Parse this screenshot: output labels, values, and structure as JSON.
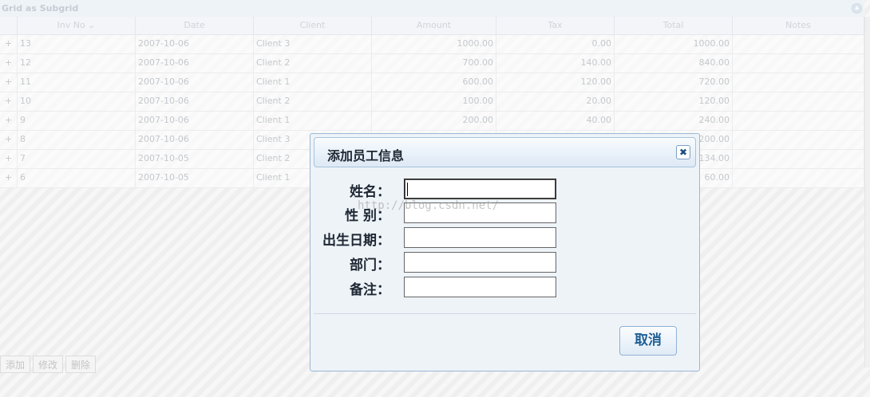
{
  "grid": {
    "caption": "Grid as Subgrid",
    "columns": [
      "Inv No",
      "Date",
      "Client",
      "Amount",
      "Tax",
      "Total",
      "Notes"
    ],
    "sort_indicator": "⌄",
    "rows": [
      {
        "inv": "13",
        "date": "2007-10-06",
        "client": "Client 3",
        "amount": "1000.00",
        "tax": "0.00",
        "total": "1000.00",
        "notes": ""
      },
      {
        "inv": "12",
        "date": "2007-10-06",
        "client": "Client 2",
        "amount": "700.00",
        "tax": "140.00",
        "total": "840.00",
        "notes": ""
      },
      {
        "inv": "11",
        "date": "2007-10-06",
        "client": "Client 1",
        "amount": "600.00",
        "tax": "120.00",
        "total": "720.00",
        "notes": ""
      },
      {
        "inv": "10",
        "date": "2007-10-06",
        "client": "Client 2",
        "amount": "100.00",
        "tax": "20.00",
        "total": "120.00",
        "notes": ""
      },
      {
        "inv": "9",
        "date": "2007-10-06",
        "client": "Client 1",
        "amount": "200.00",
        "tax": "40.00",
        "total": "240.00",
        "notes": ""
      },
      {
        "inv": "8",
        "date": "2007-10-06",
        "client": "Client 3",
        "amount": "",
        "tax": "",
        "total": "200.00",
        "notes": ""
      },
      {
        "inv": "7",
        "date": "2007-10-05",
        "client": "Client 2",
        "amount": "",
        "tax": "",
        "total": "134.00",
        "notes": ""
      },
      {
        "inv": "6",
        "date": "2007-10-05",
        "client": "Client 1",
        "amount": "",
        "tax": "",
        "total": "60.00",
        "notes": ""
      }
    ],
    "expand_glyph": "+"
  },
  "pager": {
    "add": "添加",
    "edit": "修改",
    "delete": "删除"
  },
  "dialog": {
    "title": "添加员工信息",
    "close_glyph": "✖",
    "fields": [
      {
        "label": "姓名：",
        "value": ""
      },
      {
        "label": "性 别：",
        "value": ""
      },
      {
        "label": "出生日期：",
        "value": ""
      },
      {
        "label": "部门：",
        "value": ""
      },
      {
        "label": "备注：",
        "value": ""
      }
    ],
    "cancel_label": "取消"
  },
  "watermark": "http://blog.csdn.net/",
  "icons": {
    "close": "close-icon",
    "collapse": "collapse-icon",
    "expand": "plus-icon"
  },
  "colors": {
    "dialog_border": "#9ab8d6",
    "dialog_bg": "#eef3f8",
    "button_text": "#1d5f96"
  }
}
